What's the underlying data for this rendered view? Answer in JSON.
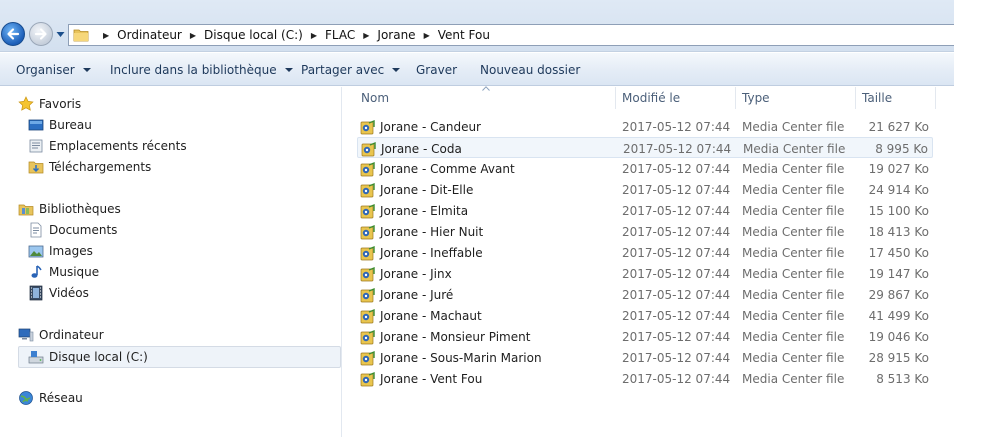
{
  "address_bar": {
    "breadcrumbs": [
      "Ordinateur",
      "Disque local (C:)",
      "FLAC",
      "Jorane",
      "Vent Fou"
    ]
  },
  "toolbar": {
    "organize": "Organiser",
    "include_library": "Inclure dans la bibliothèque",
    "share_with": "Partager avec",
    "burn": "Graver",
    "new_folder": "Nouveau dossier"
  },
  "navigation": {
    "favorites": {
      "label": "Favoris",
      "items": [
        "Bureau",
        "Emplacements récents",
        "Téléchargements"
      ]
    },
    "libraries": {
      "label": "Bibliothèques",
      "items": [
        "Documents",
        "Images",
        "Musique",
        "Vidéos"
      ]
    },
    "computer": {
      "label": "Ordinateur",
      "items": [
        "Disque local (C:)"
      ]
    },
    "network": {
      "label": "Réseau"
    }
  },
  "file_list": {
    "columns": [
      "Nom",
      "Modifié le",
      "Type",
      "Taille"
    ],
    "rows": [
      {
        "name": "Jorane - Candeur",
        "date": "2017-05-12 07:44",
        "type": "Media Center file",
        "size": "21 627 Ko"
      },
      {
        "name": "Jorane - Coda",
        "date": "2017-05-12 07:44",
        "type": "Media Center file",
        "size": "8 995 Ko"
      },
      {
        "name": "Jorane - Comme Avant",
        "date": "2017-05-12 07:44",
        "type": "Media Center file",
        "size": "19 027 Ko"
      },
      {
        "name": "Jorane - Dit-Elle",
        "date": "2017-05-12 07:44",
        "type": "Media Center file",
        "size": "24 914 Ko"
      },
      {
        "name": "Jorane - Elmita",
        "date": "2017-05-12 07:44",
        "type": "Media Center file",
        "size": "15 100 Ko"
      },
      {
        "name": "Jorane - Hier Nuit",
        "date": "2017-05-12 07:44",
        "type": "Media Center file",
        "size": "18 413 Ko"
      },
      {
        "name": "Jorane - Ineffable",
        "date": "2017-05-12 07:44",
        "type": "Media Center file",
        "size": "17 450 Ko"
      },
      {
        "name": "Jorane - Jinx",
        "date": "2017-05-12 07:44",
        "type": "Media Center file",
        "size": "19 147 Ko"
      },
      {
        "name": "Jorane - Juré",
        "date": "2017-05-12 07:44",
        "type": "Media Center file",
        "size": "29 867 Ko"
      },
      {
        "name": "Jorane - Machaut",
        "date": "2017-05-12 07:44",
        "type": "Media Center file",
        "size": "41 499 Ko"
      },
      {
        "name": "Jorane - Monsieur Piment",
        "date": "2017-05-12 07:44",
        "type": "Media Center file",
        "size": "19 046 Ko"
      },
      {
        "name": "Jorane - Sous-Marin Marion",
        "date": "2017-05-12 07:44",
        "type": "Media Center file",
        "size": "28 915 Ko"
      },
      {
        "name": "Jorane - Vent Fou",
        "date": "2017-05-12 07:44",
        "type": "Media Center file",
        "size": "8 513 Ko"
      }
    ]
  },
  "colors": {
    "toolbar_text": "#1e395b",
    "accent_blue": "#1c5eb8",
    "secondary_text": "#6d6d6d"
  }
}
